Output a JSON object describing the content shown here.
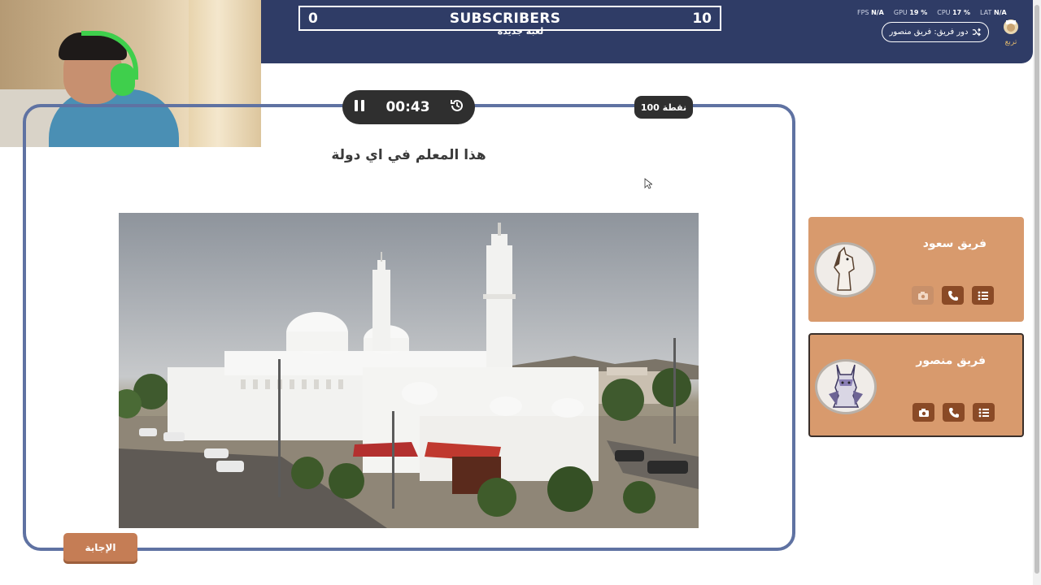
{
  "header": {
    "subscribers_left": "0",
    "subscribers_title": "SUBSCRIBERS",
    "subscribers_right": "10",
    "new_game": "لعبة جديدة",
    "team_turn": "دور فريق: فريق منصور",
    "logo_text": "تربع",
    "stats": [
      {
        "label": "FPS",
        "value": "N/A"
      },
      {
        "label": "GPU",
        "value": "19 %"
      },
      {
        "label": "CPU",
        "value": "17 %"
      },
      {
        "label": "LAT",
        "value": "N/A"
      }
    ]
  },
  "question": {
    "timer": "00:43",
    "points": "100 نقطة",
    "text": "هذا المعلم في اي دولة",
    "answer_button": "الإجابة"
  },
  "teams": [
    {
      "name": "فريق سعود",
      "mascot": "horse-mascot-icon",
      "camera_enabled": false
    },
    {
      "name": "فريق منصور",
      "mascot": "donkey-mascot-icon",
      "camera_enabled": true
    }
  ],
  "colors": {
    "header": "#2f3c66",
    "panel_border": "#5f72a2",
    "team_card": "#d89a6d",
    "team_action": "#8a4a26",
    "answer_button": "#c57d55"
  }
}
